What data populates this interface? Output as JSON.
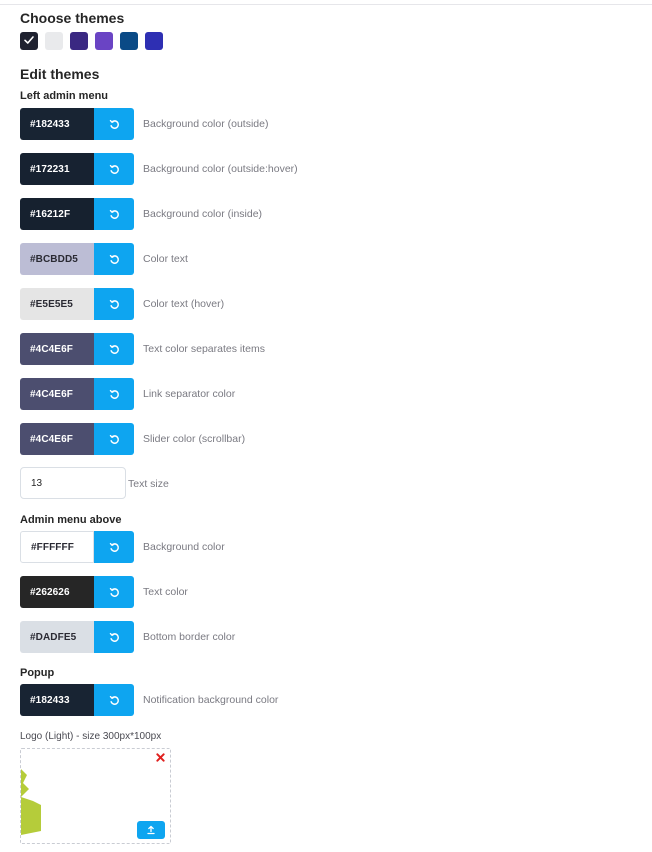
{
  "choose_themes": {
    "title": "Choose themes",
    "swatches": [
      {
        "name": "dark",
        "color": "#1f2230",
        "selected": true
      },
      {
        "name": "light",
        "color": "#e9eaec",
        "selected": false
      },
      {
        "name": "indigo",
        "color": "#3a2882",
        "selected": false
      },
      {
        "name": "violet",
        "color": "#6a44c4",
        "selected": false
      },
      {
        "name": "navy",
        "color": "#0a4a86",
        "selected": false
      },
      {
        "name": "blue",
        "color": "#2e2fb3",
        "selected": false
      }
    ]
  },
  "edit_themes": {
    "title": "Edit themes",
    "left_admin_menu": {
      "title": "Left admin menu",
      "fields": [
        {
          "value": "#182433",
          "label": "Background color (outside)",
          "bg": "#182433",
          "fg": "#ffffff"
        },
        {
          "value": "#172231",
          "label": "Background color (outside:hover)",
          "bg": "#172231",
          "fg": "#ffffff"
        },
        {
          "value": "#16212F",
          "label": "Background color (inside)",
          "bg": "#16212F",
          "fg": "#ffffff"
        },
        {
          "value": "#BCBDD5",
          "label": "Color text",
          "bg": "#BCBDD5",
          "fg": "#2a2a33"
        },
        {
          "value": "#E5E5E5",
          "label": "Color text (hover)",
          "bg": "#E5E5E5",
          "fg": "#2a2a33"
        },
        {
          "value": "#4C4E6F",
          "label": "Text color separates items",
          "bg": "#4C4E6F",
          "fg": "#ffffff"
        },
        {
          "value": "#4C4E6F",
          "label": "Link separator color",
          "bg": "#4C4E6F",
          "fg": "#ffffff"
        },
        {
          "value": "#4C4E6F",
          "label": "Slider color (scrollbar)",
          "bg": "#4C4E6F",
          "fg": "#ffffff"
        }
      ],
      "text_size": {
        "value": "13",
        "label": "Text size"
      }
    },
    "admin_menu_above": {
      "title": "Admin menu above",
      "fields": [
        {
          "value": "#FFFFFF",
          "label": "Background color",
          "bg": "#FFFFFF",
          "fg": "#2a2a33"
        },
        {
          "value": "#262626",
          "label": "Text color",
          "bg": "#262626",
          "fg": "#ffffff"
        },
        {
          "value": "#DADFE5",
          "label": "Bottom border color",
          "bg": "#DADFE5",
          "fg": "#2a2a33"
        }
      ]
    },
    "popup": {
      "title": "Popup",
      "fields": [
        {
          "value": "#182433",
          "label": "Notification background color",
          "bg": "#182433",
          "fg": "#ffffff"
        }
      ]
    },
    "logo_light": {
      "label": "Logo (Light) - size 300px*100px",
      "shape_color": "#b5cc3a"
    }
  },
  "colors": {
    "accent": "#0ea5f0",
    "remove": "#e0201e"
  },
  "icons": {
    "reset": "reset-icon",
    "upload": "upload-icon",
    "remove": "close-icon",
    "selected": "check-icon"
  }
}
